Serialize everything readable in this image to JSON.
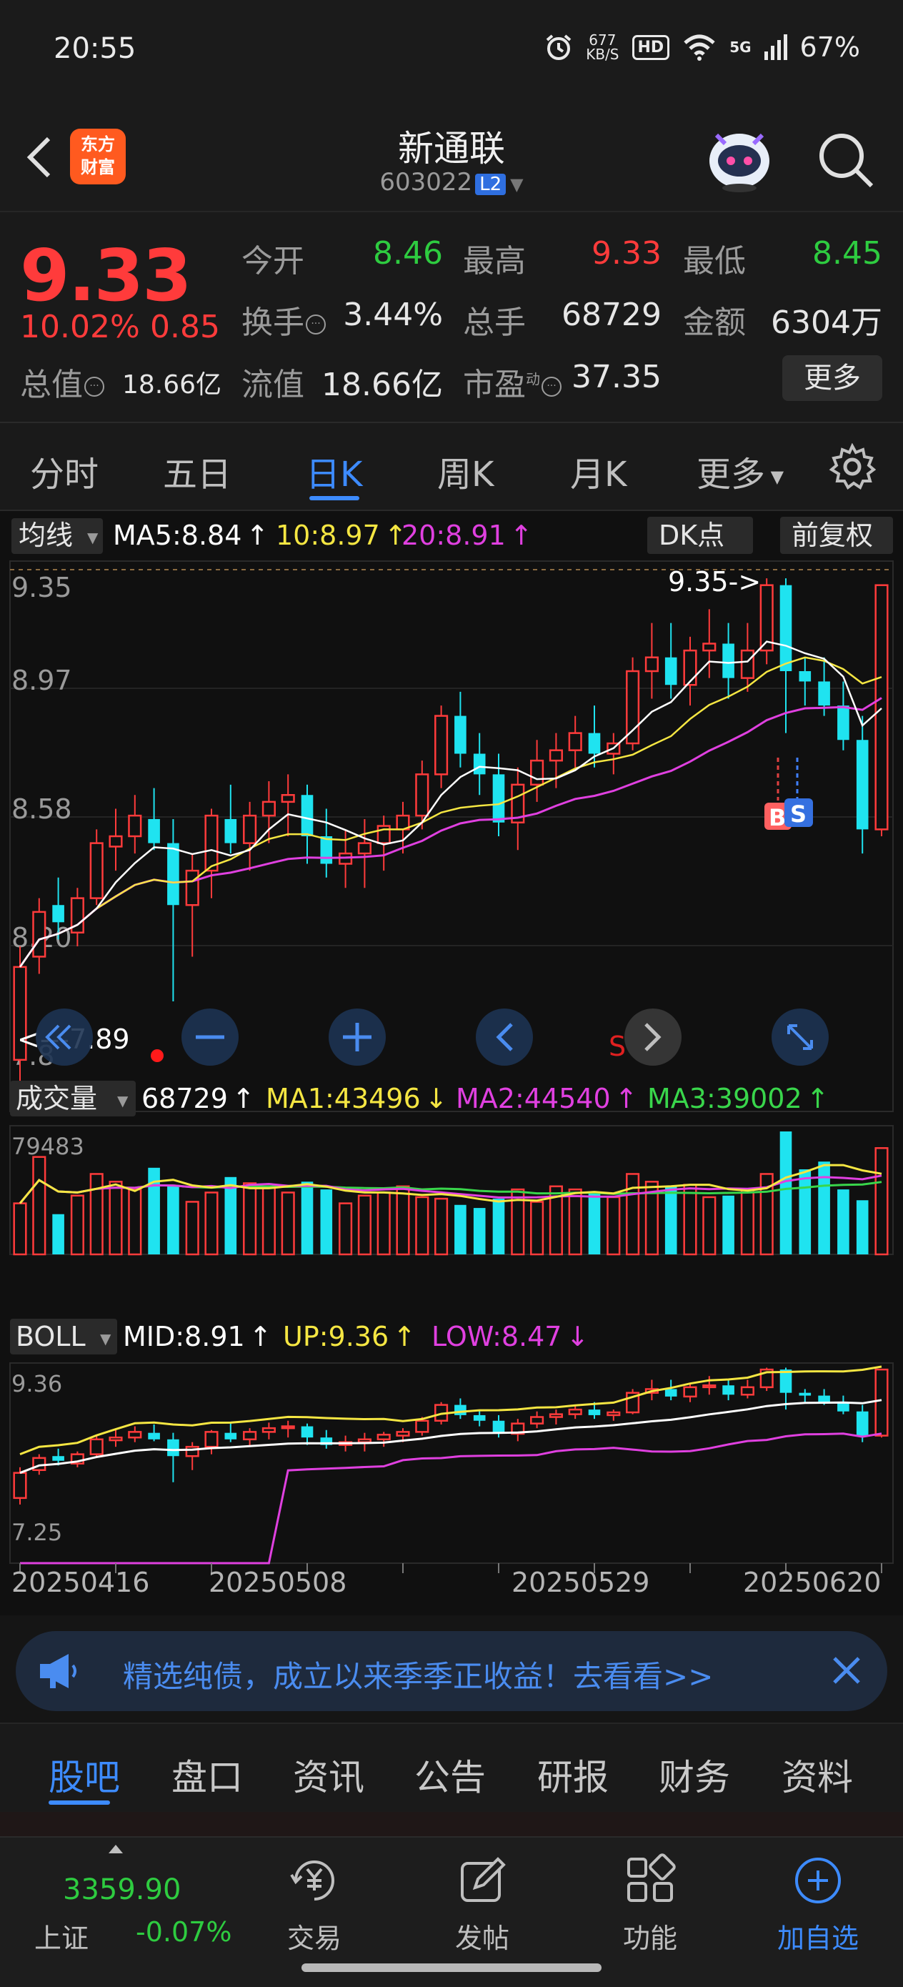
{
  "status_bar": {
    "time": "20:55",
    "net_speed": "677",
    "net_unit": "KB/S",
    "hd": "HD",
    "signal": "5G",
    "battery": "67%"
  },
  "header": {
    "title": "新通联",
    "code": "603022",
    "level": "L2",
    "logo_line1": "东方",
    "logo_line2": "财富"
  },
  "quote": {
    "price": "9.33",
    "change_pct": "10.02%",
    "change": "0.85",
    "fields": [
      {
        "label": "今开",
        "value": "8.46"
      },
      {
        "label": "最高",
        "value": "9.33"
      },
      {
        "label": "最低",
        "value": "8.45"
      },
      {
        "label": "换手",
        "value": "3.44%"
      },
      {
        "label": "总手",
        "value": "68729"
      },
      {
        "label": "金额",
        "value": "6304万"
      },
      {
        "label": "总值",
        "value": "18.66亿"
      },
      {
        "label": "流值",
        "value": "18.66亿"
      },
      {
        "label": "市盈",
        "sup": "动",
        "value": "37.35"
      }
    ],
    "more_label": "更多"
  },
  "period_tabs": [
    "分时",
    "五日",
    "日K",
    "周K",
    "月K",
    "更多"
  ],
  "active_period": "日K",
  "colors": {
    "up": "#ff3b3b",
    "down": "#1fe3f0",
    "accent": "#3d8bff",
    "ma5": "#ffffff",
    "ma10": "#f5e642",
    "ma20": "#e040e0",
    "ma3": "#39d64b"
  },
  "main_chart": {
    "indicator": "均线",
    "legend": [
      {
        "text": "MA5:8.84",
        "arrow": "↑"
      },
      {
        "text": "10:8.97",
        "arrow": "↑"
      },
      {
        "text": "20:8.91",
        "arrow": "↑"
      }
    ],
    "dk_label": "DK点",
    "adjust_label": "前复权",
    "y_labels": [
      "9.35",
      "8.97",
      "8.58",
      "8.20",
      "7.8"
    ],
    "high_marker": "9.35->",
    "low_marker": "<---7.89",
    "bs_buy": "B",
    "bs_sell": "S",
    "s_mark": "S"
  },
  "volume_chart": {
    "indicator": "成交量",
    "legend": [
      {
        "text": "68729",
        "arrow": "↑"
      },
      {
        "text": "MA1:43496",
        "arrow": "↓"
      },
      {
        "text": "MA2:44540",
        "arrow": "↑"
      },
      {
        "text": "MA3:39002",
        "arrow": "↑"
      }
    ],
    "y_label": "79483"
  },
  "boll_chart": {
    "indicator": "BOLL",
    "legend": [
      {
        "text": "MID:8.91",
        "arrow": "↑"
      },
      {
        "text": "UP:9.36",
        "arrow": "↑"
      },
      {
        "text": "LOW:8.47",
        "arrow": "↓"
      }
    ],
    "y_labels": [
      "9.36",
      "7.25"
    ],
    "x_labels": [
      "20250416",
      "20250508",
      "20250529",
      "20250620"
    ]
  },
  "chart_data": {
    "type": "candlestick",
    "candles": [
      {
        "o": 7.95,
        "h": 8.28,
        "l": 7.88,
        "c": 8.22
      },
      {
        "o": 8.25,
        "h": 8.42,
        "l": 8.2,
        "c": 8.38
      },
      {
        "o": 8.4,
        "h": 8.48,
        "l": 8.3,
        "c": 8.35
      },
      {
        "o": 8.32,
        "h": 8.45,
        "l": 8.28,
        "c": 8.42
      },
      {
        "o": 8.42,
        "h": 8.62,
        "l": 8.4,
        "c": 8.58
      },
      {
        "o": 8.57,
        "h": 8.68,
        "l": 8.5,
        "c": 8.6
      },
      {
        "o": 8.6,
        "h": 8.72,
        "l": 8.55,
        "c": 8.66
      },
      {
        "o": 8.65,
        "h": 8.74,
        "l": 8.56,
        "c": 8.58
      },
      {
        "o": 8.58,
        "h": 8.65,
        "l": 8.12,
        "c": 8.4
      },
      {
        "o": 8.4,
        "h": 8.55,
        "l": 8.25,
        "c": 8.5
      },
      {
        "o": 8.5,
        "h": 8.68,
        "l": 8.42,
        "c": 8.66
      },
      {
        "o": 8.65,
        "h": 8.75,
        "l": 8.55,
        "c": 8.58
      },
      {
        "o": 8.58,
        "h": 8.7,
        "l": 8.5,
        "c": 8.66
      },
      {
        "o": 8.66,
        "h": 8.76,
        "l": 8.58,
        "c": 8.7
      },
      {
        "o": 8.7,
        "h": 8.78,
        "l": 8.6,
        "c": 8.72
      },
      {
        "o": 8.72,
        "h": 8.75,
        "l": 8.52,
        "c": 8.6
      },
      {
        "o": 8.6,
        "h": 8.68,
        "l": 8.48,
        "c": 8.52
      },
      {
        "o": 8.52,
        "h": 8.62,
        "l": 8.45,
        "c": 8.55
      },
      {
        "o": 8.55,
        "h": 8.65,
        "l": 8.45,
        "c": 8.58
      },
      {
        "o": 8.58,
        "h": 8.66,
        "l": 8.5,
        "c": 8.63
      },
      {
        "o": 8.62,
        "h": 8.7,
        "l": 8.55,
        "c": 8.66
      },
      {
        "o": 8.66,
        "h": 8.82,
        "l": 8.62,
        "c": 8.78
      },
      {
        "o": 8.78,
        "h": 8.98,
        "l": 8.74,
        "c": 8.95
      },
      {
        "o": 8.95,
        "h": 9.02,
        "l": 8.8,
        "c": 8.84
      },
      {
        "o": 8.84,
        "h": 8.9,
        "l": 8.72,
        "c": 8.78
      },
      {
        "o": 8.78,
        "h": 8.84,
        "l": 8.6,
        "c": 8.64
      },
      {
        "o": 8.64,
        "h": 8.8,
        "l": 8.56,
        "c": 8.75
      },
      {
        "o": 8.75,
        "h": 8.88,
        "l": 8.7,
        "c": 8.82
      },
      {
        "o": 8.82,
        "h": 8.9,
        "l": 8.74,
        "c": 8.85
      },
      {
        "o": 8.85,
        "h": 8.95,
        "l": 8.8,
        "c": 8.9
      },
      {
        "o": 8.9,
        "h": 8.98,
        "l": 8.8,
        "c": 8.84
      },
      {
        "o": 8.84,
        "h": 8.9,
        "l": 8.78,
        "c": 8.87
      },
      {
        "o": 8.87,
        "h": 9.12,
        "l": 8.85,
        "c": 9.08
      },
      {
        "o": 9.08,
        "h": 9.22,
        "l": 9.0,
        "c": 9.12
      },
      {
        "o": 9.12,
        "h": 9.22,
        "l": 9.0,
        "c": 9.04
      },
      {
        "o": 9.04,
        "h": 9.18,
        "l": 8.98,
        "c": 9.14
      },
      {
        "o": 9.14,
        "h": 9.26,
        "l": 9.06,
        "c": 9.16
      },
      {
        "o": 9.16,
        "h": 9.22,
        "l": 9.0,
        "c": 9.06
      },
      {
        "o": 9.06,
        "h": 9.22,
        "l": 9.02,
        "c": 9.14
      },
      {
        "o": 9.14,
        "h": 9.35,
        "l": 9.1,
        "c": 9.33
      },
      {
        "o": 9.33,
        "h": 9.35,
        "l": 8.9,
        "c": 9.08
      },
      {
        "o": 9.08,
        "h": 9.12,
        "l": 8.98,
        "c": 9.05
      },
      {
        "o": 9.05,
        "h": 9.12,
        "l": 8.95,
        "c": 8.98
      },
      {
        "o": 8.98,
        "h": 9.05,
        "l": 8.85,
        "c": 8.88
      },
      {
        "o": 8.88,
        "h": 8.95,
        "l": 8.55,
        "c": 8.62
      },
      {
        "o": 8.62,
        "h": 9.33,
        "l": 8.6,
        "c": 9.33
      }
    ],
    "y_range": [
      7.8,
      9.4
    ],
    "volumes": [
      33000,
      63000,
      26000,
      38000,
      52000,
      47000,
      42000,
      56000,
      44000,
      34000,
      40000,
      50000,
      46000,
      44000,
      40000,
      47000,
      42000,
      33000,
      38000,
      40000,
      44000,
      37000,
      36000,
      32000,
      30000,
      36000,
      42000,
      34000,
      44000,
      42000,
      40000,
      37000,
      52000,
      47000,
      44000,
      45000,
      37000,
      38000,
      42000,
      52000,
      79483,
      55000,
      60000,
      42000,
      35000,
      68729
    ],
    "volume_range": [
      0,
      79483
    ],
    "boll_range": [
      7.25,
      9.4
    ],
    "x_tick_labels": [
      "20250416",
      "20250508",
      "20250529",
      "20250620"
    ]
  },
  "banner": {
    "text": "精选纯债，成立以来季季正收益！去看看>>"
  },
  "bottom_tabs": [
    "股吧",
    "盘口",
    "资讯",
    "公告",
    "研报",
    "财务",
    "资料"
  ],
  "active_bottom_tab": "股吧",
  "dock": {
    "index_value": "3359.90",
    "index_name": "上证",
    "index_pct": "-0.07%",
    "items": [
      {
        "label": "交易",
        "icon": "trade-icon"
      },
      {
        "label": "发帖",
        "icon": "post-icon"
      },
      {
        "label": "功能",
        "icon": "function-icon"
      },
      {
        "label": "加自选",
        "icon": "add-watchlist-icon"
      }
    ]
  }
}
